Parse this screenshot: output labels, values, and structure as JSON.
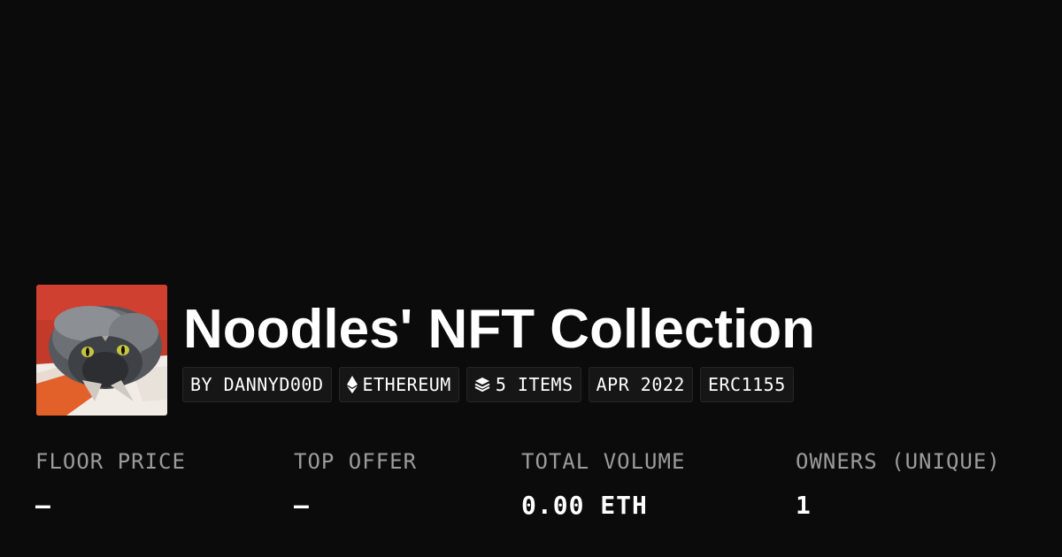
{
  "collection": {
    "title": "Noodles' NFT Collection",
    "avatar_alt": "Cat photo avatar"
  },
  "tags": [
    {
      "icon": "none",
      "label": "BY DANNYD00D"
    },
    {
      "icon": "ethereum-icon",
      "label": "ETHEREUM"
    },
    {
      "icon": "layers-icon",
      "label": "5 ITEMS"
    },
    {
      "icon": "none",
      "label": "APR 2022"
    },
    {
      "icon": "none",
      "label": "ERC1155"
    }
  ],
  "stats": [
    {
      "label": "FLOOR PRICE",
      "value": "–"
    },
    {
      "label": "TOP OFFER",
      "value": "–"
    },
    {
      "label": "TOTAL VOLUME",
      "value": "0.00 ETH"
    },
    {
      "label": "OWNERS (UNIQUE)",
      "value": "1"
    }
  ],
  "colors": {
    "background": "#0b0b0b",
    "text": "#ffffff",
    "muted": "#9c9c9c",
    "tag_bg": "#161616",
    "tag_border": "#262626"
  }
}
